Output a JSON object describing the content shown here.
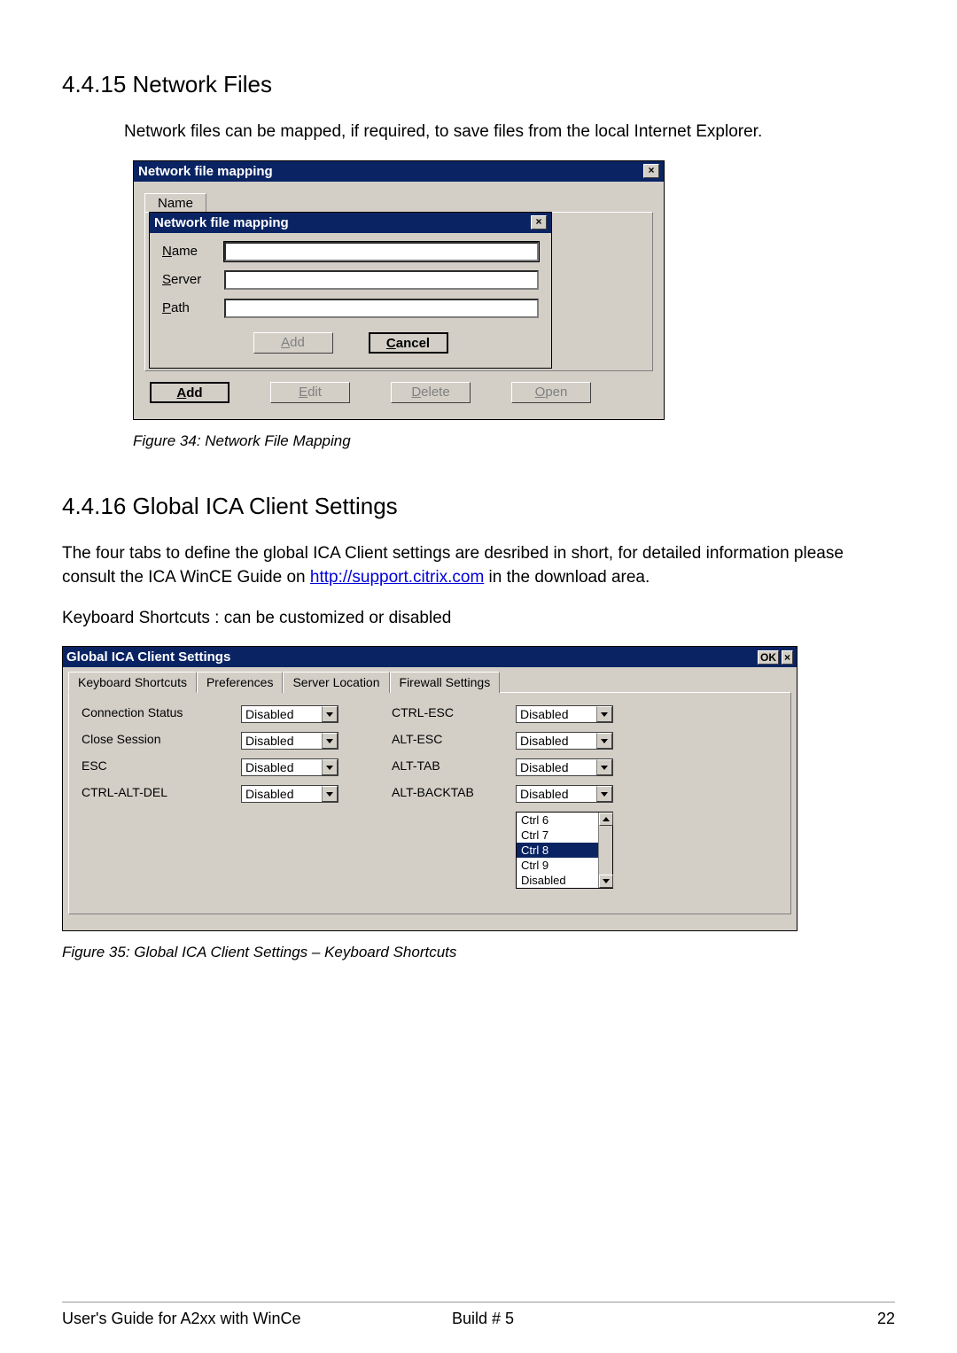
{
  "section1": {
    "heading": "4.4.15 Network Files",
    "intro": "Network files can be mapped, if required, to save files from the local Internet Explorer.",
    "figure_caption": "Figure 34: Network File Mapping"
  },
  "dialog1": {
    "title": "Network file mapping",
    "close": "×",
    "tab_name": "Name",
    "inner_title": "Network file mapping",
    "labels": {
      "name_u": "N",
      "name_rest": "ame",
      "server_u": "S",
      "server_rest": "erver",
      "path_u": "P",
      "path_rest": "ath"
    },
    "inner_add_u": "A",
    "inner_add_rest": "dd",
    "inner_cancel_u": "C",
    "inner_cancel_rest": "ancel",
    "outer_add_u": "A",
    "outer_add_rest": "dd",
    "outer_edit_u": "E",
    "outer_edit_rest": "dit",
    "outer_delete_u": "D",
    "outer_delete_rest": "elete",
    "outer_open_u": "O",
    "outer_open_rest": "pen"
  },
  "section2": {
    "heading": "4.4.16 Global ICA Client Settings",
    "p1_a": "The four tabs to define the global ICA Client settings are desribed in short, for detailed information please consult the ICA WinCE Guide on ",
    "link": "http://support.citrix.com",
    "p1_b": " in the download area.",
    "p2": "Keyboard Shortcuts   : can be customized or disabled",
    "figure_caption": "Figure 35: Global ICA Client Settings – Keyboard Shortcuts"
  },
  "ica": {
    "title": "Global ICA Client Settings",
    "ok": "OK",
    "close": "×",
    "tabs": [
      "Keyboard Shortcuts",
      "Preferences",
      "Server Location",
      "Firewall Settings"
    ],
    "rows": [
      {
        "l1": "Connection Status",
        "v1": "Disabled",
        "l2": "CTRL-ESC",
        "v2": "Disabled"
      },
      {
        "l1": "Close Session",
        "v1": "Disabled",
        "l2": "ALT-ESC",
        "v2": "Disabled"
      },
      {
        "l1": "ESC",
        "v1": "Disabled",
        "l2": "ALT-TAB",
        "v2": "Disabled"
      },
      {
        "l1": "CTRL-ALT-DEL",
        "v1": "Disabled",
        "l2": "ALT-BACKTAB",
        "v2": "Disabled"
      }
    ],
    "listbox": [
      "Ctrl 6",
      "Ctrl 7",
      "Ctrl 8",
      "Ctrl 9",
      "Disabled"
    ],
    "listbox_selected_index": 2
  },
  "footer": {
    "left": "User's Guide for A2xx with WinCe",
    "mid": "Build # 5",
    "right": "22"
  }
}
